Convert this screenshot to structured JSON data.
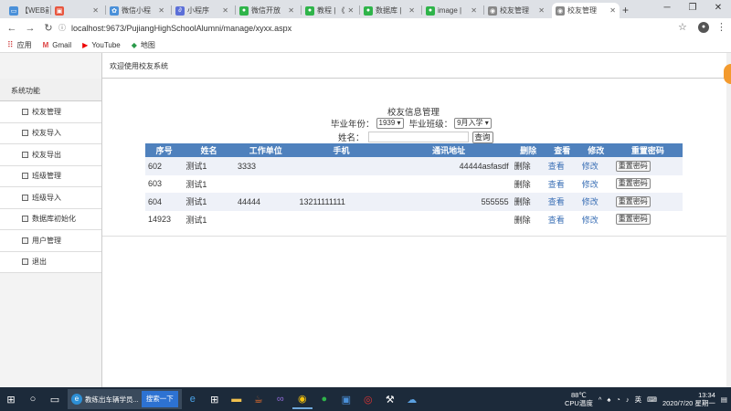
{
  "browser": {
    "tabs": [
      {
        "label": "【WEB前",
        "color": "#4a90d9",
        "glyph": "▭"
      },
      {
        "label": "",
        "color": "#e8563f",
        "glyph": "▣"
      },
      {
        "label": "微信小程",
        "color": "#4a90d9",
        "glyph": "✿"
      },
      {
        "label": "小程序",
        "color": "#5b6fd8",
        "glyph": "∂"
      },
      {
        "label": "微信开放",
        "color": "#2fb44a",
        "glyph": "●"
      },
      {
        "label": "教程 | 《",
        "color": "#2fb44a",
        "glyph": "●"
      },
      {
        "label": "数据库 |",
        "color": "#2fb44a",
        "glyph": "●"
      },
      {
        "label": "image |",
        "color": "#2fb44a",
        "glyph": "●"
      },
      {
        "label": "校友管理",
        "color": "#888888",
        "glyph": "◉"
      },
      {
        "label": "校友管理",
        "color": "#888888",
        "glyph": "◉"
      }
    ],
    "active_tab_index": 9,
    "new_tab": "+",
    "url": "localhost:9673/PujiangHighSchoolAlumni/manage/xyxx.aspx",
    "bookmarks": [
      {
        "label": "应用",
        "icon": "apps-grid-icon"
      },
      {
        "label": "Gmail",
        "icon": "gmail-icon"
      },
      {
        "label": "YouTube",
        "icon": "youtube-icon"
      },
      {
        "label": "地图",
        "icon": "maps-icon"
      }
    ]
  },
  "header": {
    "welcome": "欢迎使用校友系统"
  },
  "sidebar": {
    "title": "系统功能",
    "items": [
      {
        "label": "校友管理"
      },
      {
        "label": "校友导入"
      },
      {
        "label": "校友导出"
      },
      {
        "label": "班级管理"
      },
      {
        "label": "班级导入"
      },
      {
        "label": "数据库初始化"
      },
      {
        "label": "用户管理"
      },
      {
        "label": "退出"
      }
    ]
  },
  "form": {
    "title": "校友信息管理",
    "year_label": "毕业年份：",
    "year_value": "1939",
    "class_label": "毕业班级：",
    "class_value": "9月入学",
    "name_label": "姓名：",
    "name_value": "",
    "search_button": "查询"
  },
  "table": {
    "headers": [
      "序号",
      "姓名",
      "工作单位",
      "手机",
      "通讯地址",
      "删除",
      "查看",
      "修改",
      "重置密码"
    ],
    "rows": [
      {
        "id": "602",
        "name": "测试1",
        "work": "3333",
        "phone": "",
        "address": "44444asfasdf",
        "delete": "删除",
        "view": "查看",
        "edit": "修改",
        "reset": "重置密码"
      },
      {
        "id": "603",
        "name": "测试1",
        "work": "",
        "phone": "",
        "address": "",
        "delete": "删除",
        "view": "查看",
        "edit": "修改",
        "reset": "重置密码"
      },
      {
        "id": "604",
        "name": "测试1",
        "work": "44444",
        "phone": "13211111111",
        "address": "555555",
        "delete": "删除",
        "view": "查看",
        "edit": "修改",
        "reset": "重置密码"
      },
      {
        "id": "14923",
        "name": "测试1",
        "work": "",
        "phone": "",
        "address": "",
        "delete": "删除",
        "view": "查看",
        "edit": "修改",
        "reset": "重置密码"
      }
    ]
  },
  "taskbar": {
    "ie_label": "教练出车辆学员...",
    "search_label": "搜索一下",
    "temp": "88℃",
    "temp_label": "CPU温度",
    "ime": "英",
    "time": "13:34",
    "date": "2020/7/20 星期一"
  }
}
